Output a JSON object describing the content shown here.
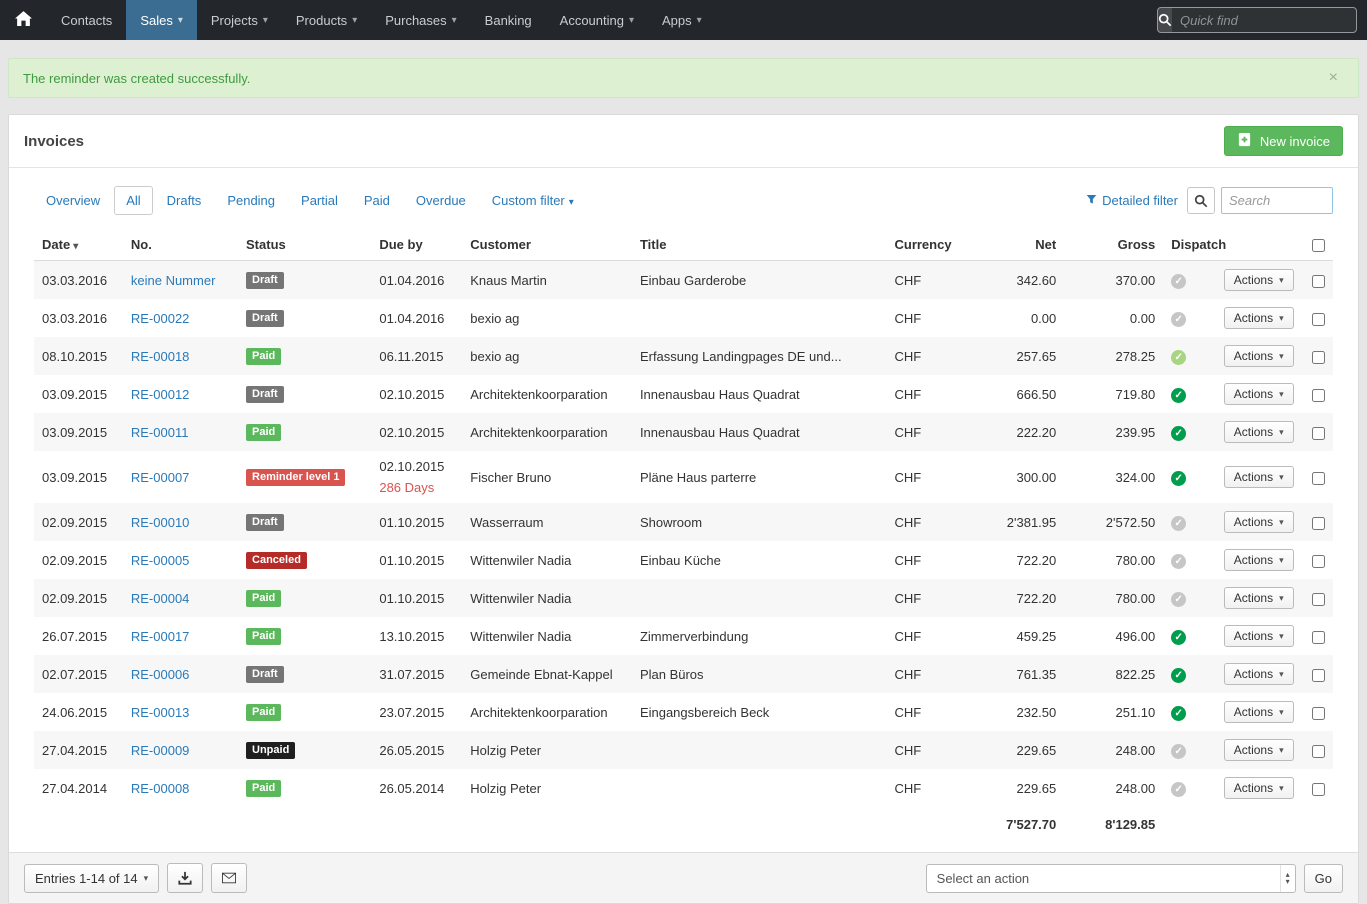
{
  "icons": {
    "caret_down": "▾",
    "arrow_up": "▴",
    "close": "×",
    "check": "✓"
  },
  "colors": {
    "navbar_bg": "#23272b",
    "navbar_active": "#3a6d91",
    "link_blue": "#2a7ab9",
    "success_bg": "#ddf0d2",
    "success_text": "#3f9b3f",
    "button_green": "#5cb85c",
    "badge_draft": "#757575",
    "badge_paid": "#5cb85c",
    "badge_reminder": "#d9534f",
    "badge_canceled": "#b52b27",
    "badge_unpaid": "#1f1f1f",
    "dispatch_gray": "#c6c6c6",
    "dispatch_light_green": "#a8d57f",
    "dispatch_green": "#009e4c",
    "overdue_red": "#d9534f"
  },
  "navbar": {
    "items": [
      {
        "label": "Contacts",
        "active": false,
        "dropdown": false
      },
      {
        "label": "Sales",
        "active": true,
        "dropdown": true
      },
      {
        "label": "Projects",
        "active": false,
        "dropdown": true
      },
      {
        "label": "Products",
        "active": false,
        "dropdown": true
      },
      {
        "label": "Purchases",
        "active": false,
        "dropdown": true
      },
      {
        "label": "Banking",
        "active": false,
        "dropdown": false
      },
      {
        "label": "Accounting",
        "active": false,
        "dropdown": true
      },
      {
        "label": "Apps",
        "active": false,
        "dropdown": true
      }
    ],
    "quick_find_placeholder": "Quick find"
  },
  "alert": {
    "message": "The reminder was created successfully.",
    "close_label": "×"
  },
  "page": {
    "title": "Invoices",
    "new_invoice_label": "New invoice"
  },
  "filters": {
    "tabs": [
      {
        "label": "Overview",
        "active": false,
        "dropdown": false
      },
      {
        "label": "All",
        "active": true,
        "dropdown": false
      },
      {
        "label": "Drafts",
        "active": false,
        "dropdown": false
      },
      {
        "label": "Pending",
        "active": false,
        "dropdown": false
      },
      {
        "label": "Partial",
        "active": false,
        "dropdown": false
      },
      {
        "label": "Paid",
        "active": false,
        "dropdown": false
      },
      {
        "label": "Overdue",
        "active": false,
        "dropdown": false
      },
      {
        "label": "Custom filter",
        "active": false,
        "dropdown": true
      }
    ],
    "detailed_filter_label": "Detailed filter",
    "search_placeholder": "Search"
  },
  "table": {
    "columns": [
      "Date",
      "No.",
      "Status",
      "Due by",
      "Customer",
      "Title",
      "Currency",
      "Net",
      "Gross",
      "Dispatch"
    ],
    "sort_column": "Date",
    "actions_label": "Actions",
    "rows": [
      {
        "date": "03.03.2016",
        "no": "keine Nummer",
        "status": {
          "label": "Draft",
          "type": "draft"
        },
        "due": "01.04.2016",
        "due_note": "",
        "customer": "Knaus Martin",
        "title": "Einbau Garderobe",
        "currency": "CHF",
        "net": "342.60",
        "gross": "370.00",
        "dispatch": "gray"
      },
      {
        "date": "03.03.2016",
        "no": "RE-00022",
        "status": {
          "label": "Draft",
          "type": "draft"
        },
        "due": "01.04.2016",
        "due_note": "",
        "customer": "bexio ag",
        "title": "",
        "currency": "CHF",
        "net": "0.00",
        "gross": "0.00",
        "dispatch": "gray"
      },
      {
        "date": "08.10.2015",
        "no": "RE-00018",
        "status": {
          "label": "Paid",
          "type": "paid"
        },
        "due": "06.11.2015",
        "due_note": "",
        "customer": "bexio ag",
        "title": "Erfassung Landingpages DE und...",
        "currency": "CHF",
        "net": "257.65",
        "gross": "278.25",
        "dispatch": "light"
      },
      {
        "date": "03.09.2015",
        "no": "RE-00012",
        "status": {
          "label": "Draft",
          "type": "draft"
        },
        "due": "02.10.2015",
        "due_note": "",
        "customer": "Architektenkoorparation",
        "title": "Innenausbau Haus Quadrat",
        "currency": "CHF",
        "net": "666.50",
        "gross": "719.80",
        "dispatch": "green"
      },
      {
        "date": "03.09.2015",
        "no": "RE-00011",
        "status": {
          "label": "Paid",
          "type": "paid"
        },
        "due": "02.10.2015",
        "due_note": "",
        "customer": "Architektenkoorparation",
        "title": "Innenausbau Haus Quadrat",
        "currency": "CHF",
        "net": "222.20",
        "gross": "239.95",
        "dispatch": "green"
      },
      {
        "date": "03.09.2015",
        "no": "RE-00007",
        "status": {
          "label": "Reminder level 1",
          "type": "reminder"
        },
        "due": "02.10.2015",
        "due_note": "286 Days",
        "customer": "Fischer Bruno",
        "title": "Pläne Haus parterre",
        "currency": "CHF",
        "net": "300.00",
        "gross": "324.00",
        "dispatch": "green"
      },
      {
        "date": "02.09.2015",
        "no": "RE-00010",
        "status": {
          "label": "Draft",
          "type": "draft"
        },
        "due": "01.10.2015",
        "due_note": "",
        "customer": "Wasserraum",
        "title": "Showroom",
        "currency": "CHF",
        "net": "2'381.95",
        "gross": "2'572.50",
        "dispatch": "gray"
      },
      {
        "date": "02.09.2015",
        "no": "RE-00005",
        "status": {
          "label": "Canceled",
          "type": "canceled"
        },
        "due": "01.10.2015",
        "due_note": "",
        "customer": "Wittenwiler Nadia",
        "title": "Einbau Küche",
        "currency": "CHF",
        "net": "722.20",
        "gross": "780.00",
        "dispatch": "gray"
      },
      {
        "date": "02.09.2015",
        "no": "RE-00004",
        "status": {
          "label": "Paid",
          "type": "paid"
        },
        "due": "01.10.2015",
        "due_note": "",
        "customer": "Wittenwiler Nadia",
        "title": "",
        "currency": "CHF",
        "net": "722.20",
        "gross": "780.00",
        "dispatch": "gray"
      },
      {
        "date": "26.07.2015",
        "no": "RE-00017",
        "status": {
          "label": "Paid",
          "type": "paid"
        },
        "due": "13.10.2015",
        "due_note": "",
        "customer": "Wittenwiler Nadia",
        "title": "Zimmerverbindung",
        "currency": "CHF",
        "net": "459.25",
        "gross": "496.00",
        "dispatch": "green"
      },
      {
        "date": "02.07.2015",
        "no": "RE-00006",
        "status": {
          "label": "Draft",
          "type": "draft"
        },
        "due": "31.07.2015",
        "due_note": "",
        "customer": "Gemeinde Ebnat-Kappel",
        "title": "Plan Büros",
        "currency": "CHF",
        "net": "761.35",
        "gross": "822.25",
        "dispatch": "green"
      },
      {
        "date": "24.06.2015",
        "no": "RE-00013",
        "status": {
          "label": "Paid",
          "type": "paid"
        },
        "due": "23.07.2015",
        "due_note": "",
        "customer": "Architektenkoorparation",
        "title": "Eingangsbereich Beck",
        "currency": "CHF",
        "net": "232.50",
        "gross": "251.10",
        "dispatch": "green"
      },
      {
        "date": "27.04.2015",
        "no": "RE-00009",
        "status": {
          "label": "Unpaid",
          "type": "unpaid"
        },
        "due": "26.05.2015",
        "due_note": "",
        "customer": "Holzig Peter",
        "title": "",
        "currency": "CHF",
        "net": "229.65",
        "gross": "248.00",
        "dispatch": "gray"
      },
      {
        "date": "27.04.2014",
        "no": "RE-00008",
        "status": {
          "label": "Paid",
          "type": "paid"
        },
        "due": "26.05.2014",
        "due_note": "",
        "customer": "Holzig Peter",
        "title": "",
        "currency": "CHF",
        "net": "229.65",
        "gross": "248.00",
        "dispatch": "gray"
      }
    ],
    "totals": {
      "net": "7'527.70",
      "gross": "8'129.85"
    }
  },
  "footer": {
    "entries_label": "Entries 1-14 of 14",
    "action_select_value": "Select an action",
    "go_label": "Go"
  }
}
